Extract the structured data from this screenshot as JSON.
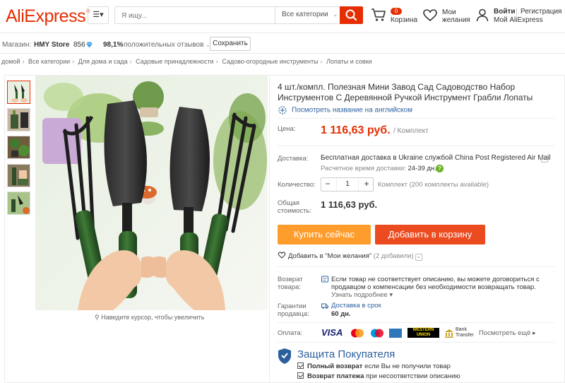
{
  "header": {
    "logo": "AliExpress",
    "logo_mark": "®",
    "menu_label": "☰▾",
    "search_placeholder": "Я ищу...",
    "category": "Все категории",
    "cart_count": "0",
    "cart_label": "Корзина",
    "wishlist_line1": "Мои",
    "wishlist_line2": "желания",
    "login": "Войти",
    "register": "Регистрация",
    "my_ali": "Мой AliExpress"
  },
  "store": {
    "prefix": "Магазин:",
    "name": "HMY Store",
    "score": "856",
    "rating": "98,1%",
    "feedback": "положительных отзывов",
    "save_label": "Сохранить"
  },
  "breadcrumbs": [
    "домой",
    "Все категории",
    "Для дома и сада",
    "Садовые принадлежности",
    "Садово-огородные инструменты",
    "Лопаты и совки"
  ],
  "gallery": {
    "zoom_hint": "Наведите курсор, чтобы увеличить"
  },
  "product": {
    "title": "4 шт./компл. Полезная Мини Завод Сад Садоводство Набор Инструментов С Деревянной Ручкой Инструмент Грабли Лопаты",
    "translate_link": "Посмотреть название на английском",
    "price_label": "Цена:",
    "price": "1 116,63 руб.",
    "price_unit": "/ Комплект",
    "shipping_label": "Доставка:",
    "shipping": "Бесплатная доставка в Ukraine службой China Post Registered Air Mail",
    "delivery_time_label": "Расчетное время доставки:",
    "delivery_time": "24-39 дн.",
    "quantity_label": "Количество:",
    "quantity": "1",
    "quantity_avail": "Комплект (200 комплекты available)",
    "total_label_1": "Общая",
    "total_label_2": "стоимость:",
    "total": "1 116,63 руб.",
    "buy_now": "Купить сейчас",
    "add_to_cart": "Добавить в корзину",
    "wishlist_add": "Добавить в \"Мои желания\"",
    "wishlist_count": "(2 добавили)",
    "return_label_1": "Возврат",
    "return_label_2": "товара:",
    "return_text": "Если товар не соответствует описанию, вы можете договориться с продавцом о компенсации без необходимости возвращать товар.",
    "return_more": "Узнать подробнее ▾",
    "guarantee_label_1": "Гарантии",
    "guarantee_label_2": "продавца:",
    "guarantee_text": "Доставка в срок",
    "guarantee_days": "60 дн.",
    "payment_label": "Оплата:",
    "pay_visa": "VISA",
    "pay_wu_1": "WESTERN",
    "pay_wu_2": "UNION",
    "pay_bank_1": "Bank",
    "pay_bank_2": "Transfer",
    "pay_more": "Посмотреть ещё ▸",
    "protection_title": "Защита Покупателя",
    "protection_1_bold": "Полный возврат",
    "protection_1_rest": " если Вы не получили товар",
    "protection_2_bold": "Возврат платежа",
    "protection_2_rest": " при несоответствии описанию"
  },
  "colors": {
    "brand": "#e62e04",
    "buy_now": "#ff9d2c",
    "add_to_cart": "#ec4a1f",
    "link": "#2b5f9e"
  }
}
